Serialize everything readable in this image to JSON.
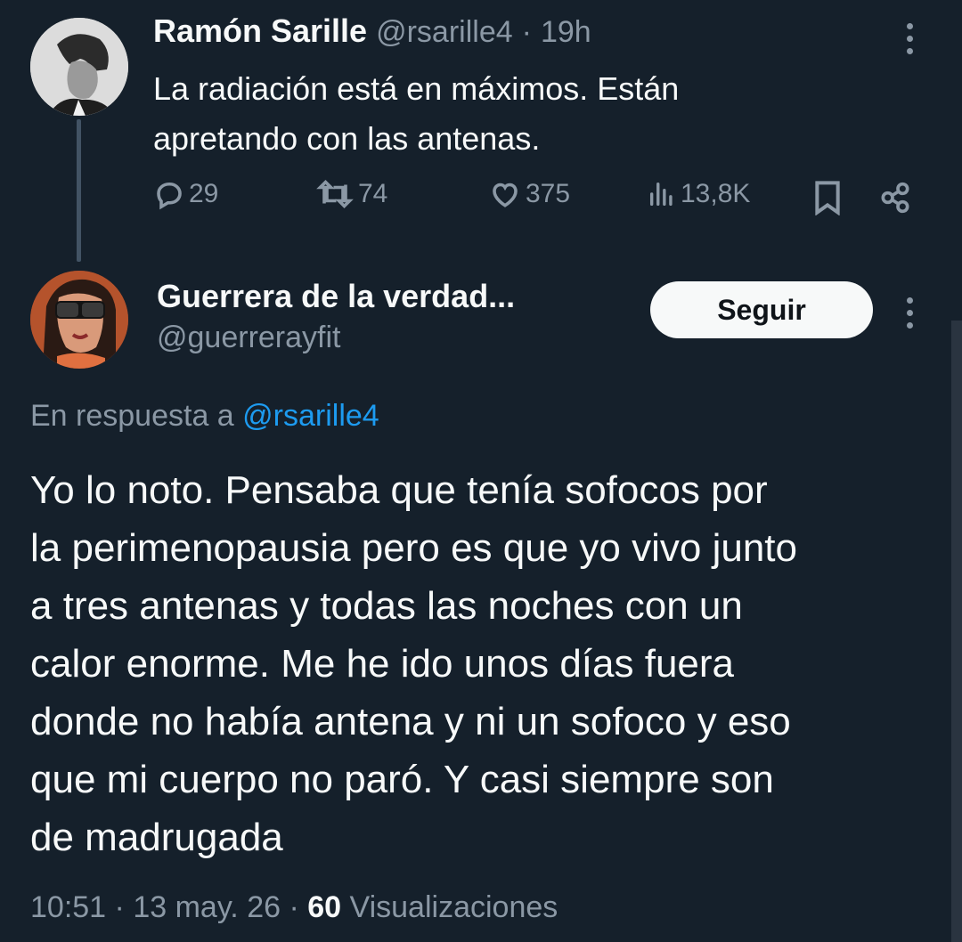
{
  "original_tweet": {
    "display_name": "Ramón Sarille",
    "handle": "@rsarille4",
    "separator": "·",
    "time": "19h",
    "text_line1": "La radiación está en máximos. Están",
    "text_line2": "apretando con las antenas.",
    "actions": {
      "replies": "29",
      "retweets": "74",
      "likes": "375",
      "views": "13,8K"
    },
    "icons": [
      "reply-icon",
      "retweet-icon",
      "like-icon",
      "views-icon",
      "bookmark-icon",
      "share-icon",
      "more-icon"
    ]
  },
  "reply_tweet": {
    "display_name": "Guerrera de la verdad...",
    "handle": "@guerrerayfit",
    "follow_label": "Seguir",
    "reply_to_prefix": "En respuesta a",
    "reply_to_handle": "@rsarille4",
    "body_lines": [
      "Yo lo noto. Pensaba que tenía sofocos por",
      "la perimenopausia pero es que yo vivo junto",
      "a tres antenas y todas las noches con un",
      "calor enorme. Me he ido unos días fuera",
      "donde no había antena y ni un sofoco y eso",
      "que mi cuerpo no paró. Y casi siempre son",
      "de madrugada"
    ],
    "meta": {
      "time": "10:51",
      "sep1": "·",
      "date": "13 may. 26",
      "sep2": "·",
      "views_count": "60",
      "views_label": "Visualizaciones"
    }
  },
  "colors": {
    "background": "#15202b",
    "text": "#f7f9f9",
    "muted": "#8b98a5",
    "link": "#1d9bf0",
    "thread_line": "#425364"
  }
}
